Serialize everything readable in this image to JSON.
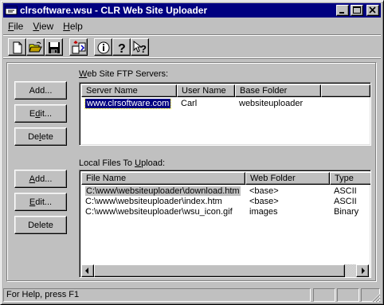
{
  "window": {
    "title": "clrsoftware.wsu - CLR Web Site Uploader",
    "icon": "app-icon",
    "controls": [
      "minimize-icon",
      "maximize-icon",
      "close-icon"
    ]
  },
  "menu": {
    "file": {
      "hotkey": "F",
      "rest": "ile"
    },
    "view": {
      "hotkey": "V",
      "rest": "iew"
    },
    "help": {
      "hotkey": "H",
      "rest": "elp"
    }
  },
  "toolbar": {
    "buttons": [
      "new-document-icon",
      "open-folder-icon",
      "save-disk-icon",
      "upload-icon",
      "info-icon",
      "help-icon",
      "context-help-icon"
    ]
  },
  "servers": {
    "label": {
      "pre": "",
      "hotkey": "W",
      "post": "eb Site FTP Servers:"
    },
    "columns": [
      "Server Name",
      "User Name",
      "Base Folder"
    ],
    "rows": [
      {
        "server": "www.clrsoftware.com",
        "user": "Carl",
        "folder": "websiteuploader"
      }
    ],
    "buttons": {
      "add": {
        "pre": "Add",
        "hotkey": "",
        "post": "..."
      },
      "edit": {
        "pre": "E",
        "hotkey": "d",
        "post": "it..."
      },
      "delete": {
        "pre": "De",
        "hotkey": "l",
        "post": "ete"
      }
    }
  },
  "files": {
    "label": {
      "pre": "Local Files To ",
      "hotkey": "U",
      "post": "pload:"
    },
    "columns": [
      "File Name",
      "Web Folder",
      "Type"
    ],
    "rows": [
      {
        "name": "C:\\www\\websiteuploader\\download.htm",
        "folder": "<base>",
        "type": "ASCII"
      },
      {
        "name": "C:\\www\\websiteuploader\\index.htm",
        "folder": "<base>",
        "type": "ASCII"
      },
      {
        "name": "C:\\www\\websiteuploader\\wsu_icon.gif",
        "folder": "images",
        "type": "Binary"
      }
    ],
    "buttons": {
      "add": {
        "pre": "",
        "hotkey": "A",
        "post": "dd..."
      },
      "edit": {
        "pre": "",
        "hotkey": "E",
        "post": "dit..."
      },
      "delete": {
        "pre": "Delete",
        "hotkey": "",
        "post": ""
      }
    }
  },
  "status": {
    "text": "For Help, press F1"
  },
  "colors": {
    "titlebar": "#000080",
    "face": "#c0c0c0",
    "selection": "#000080"
  }
}
